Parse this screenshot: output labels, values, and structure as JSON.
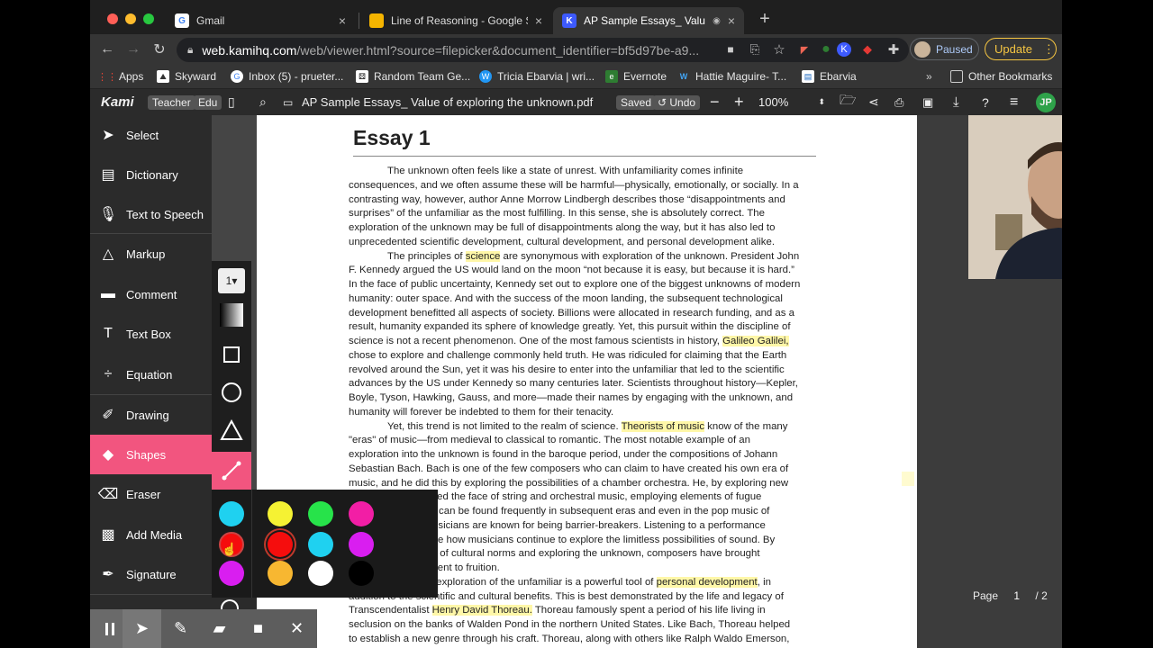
{
  "tabs": [
    {
      "title": "Gmail",
      "favicon": "google-icon"
    },
    {
      "title": "Line of Reasoning - Google Sli...",
      "favicon": "slides-icon"
    },
    {
      "title": "AP Sample Essays_ Value o...",
      "favicon": "kami-icon"
    }
  ],
  "url": {
    "host": "web.kamihq.com",
    "path": "/web/viewer.html?source=filepicker&document_identifier=bf5d97be-a9..."
  },
  "profile": {
    "status": "Paused"
  },
  "update_label": "Update",
  "bookmarks": [
    "Apps",
    "Skyward",
    "Inbox (5) - prueter...",
    "Random Team Ge...",
    "Tricia Ebarvia | wri...",
    "Evernote",
    "Hattie Maguire- T...",
    "Ebarvia"
  ],
  "other_bookmarks": "Other Bookmarks",
  "kami": {
    "logo": "Kami",
    "teacher": "Teacher",
    "edu": "Edu",
    "doc_title": "AP Sample Essays_ Value of exploring the unknown.pdf",
    "saved": "Saved",
    "undo": "Undo",
    "zoom": "100%",
    "avatar": "JP"
  },
  "sidebar": [
    {
      "label": "Select",
      "icon": "cursor-icon"
    },
    {
      "label": "Dictionary",
      "icon": "book-icon"
    },
    {
      "label": "Text to Speech",
      "icon": "speech-icon"
    },
    {
      "label": "Markup",
      "icon": "markup-icon"
    },
    {
      "label": "Comment",
      "icon": "comment-icon"
    },
    {
      "label": "Text Box",
      "icon": "text-icon"
    },
    {
      "label": "Equation",
      "icon": "divide-icon"
    },
    {
      "label": "Drawing",
      "icon": "brush-icon"
    },
    {
      "label": "Shapes",
      "icon": "shapes-icon"
    },
    {
      "label": "Eraser",
      "icon": "eraser-icon"
    },
    {
      "label": "Add Media",
      "icon": "media-icon"
    },
    {
      "label": "Signature",
      "icon": "pen-nib-icon"
    }
  ],
  "flyout": {
    "stroke_width": "1"
  },
  "palette_colors": [
    "#1fd1f0",
    "#f5f233",
    "#27e34a",
    "#f21ea5",
    "#f50d0d",
    "#f50d0d",
    "#1fd1f0",
    "#d91ef0",
    "#d91ef0",
    "#f7b731",
    "#ffffff",
    "#000000"
  ],
  "essay": {
    "title": "Essay 1",
    "lines": [
      [
        "",
        "The unknown often feels like a state of unrest. With unfamiliarity comes infinite",
        ""
      ],
      [
        "",
        "consequences, and we often assume these will be harmful—physically, emotionally, or socially. In a",
        ""
      ],
      [
        "",
        "contrasting way, however, author Anne Morrow Lindbergh describes those “disappointments and",
        ""
      ],
      [
        "",
        "surprises” of the unfamiliar as the most fulfilling. In this sense, she is absolutely correct. The",
        ""
      ],
      [
        "",
        "exploration of the unknown may be full of disappointments along the way, but it has also led to",
        ""
      ],
      [
        "",
        "unprecedented scientific development, cultural development, and personal development alike.",
        ""
      ],
      [
        "The principles of ",
        "science",
        " are synonymous with exploration of the unknown. President John"
      ],
      [
        "",
        "F. Kennedy argued the US would land on the moon “not because it is easy, but because it is hard.”",
        ""
      ],
      [
        "",
        "In the face of public uncertainty, Kennedy set out to explore one of the biggest unknowns of modern",
        ""
      ],
      [
        "",
        "humanity: outer space. And with the success of the moon landing, the subsequent technological",
        ""
      ],
      [
        "",
        "development benefitted all aspects of society. Billions were allocated in research funding, and as a",
        ""
      ],
      [
        "",
        "result, humanity expanded its sphere of knowledge greatly. Yet, this pursuit within the discipline of",
        ""
      ],
      [
        "science is not a recent phenomenon. One of the most famous scientists in history, ",
        "Galileo Galilei,",
        ""
      ],
      [
        "",
        "chose to explore and challenge commonly held truth. He was ridiculed for claiming that the Earth",
        ""
      ],
      [
        "",
        "revolved around the Sun, yet it was his desire to enter into the unfamiliar that led to the scientific",
        ""
      ],
      [
        "",
        "advances by the US under Kennedy so many centuries later. Scientists throughout history—Kepler,",
        ""
      ],
      [
        "",
        "Boyle, Tyson, Hawking, Gauss, and more—made their names by engaging with the unknown, and",
        ""
      ],
      [
        "",
        "humanity will forever be indebted to them for their tenacity.",
        ""
      ],
      [
        "Yet, this trend is not limited to the realm of science. ",
        "Theorists of music",
        " know of the many"
      ],
      [
        "",
        "\"eras\" of music—from medieval to classical to romantic. The most notable example of an",
        ""
      ],
      [
        "",
        "exploration into the unknown is found in the baroque period, under the compositions of Johann",
        ""
      ],
      [
        "",
        "Sebastian Bach. Bach is one of the few composers who can claim to have created his own era of",
        ""
      ],
      [
        "",
        "music, and he did this by exploring the possibilities of a chamber orchestra. He, by exploring new",
        ""
      ],
      [
        "",
        "ory in music, changed the face of string and orchestral music, employing elements of fugue",
        ""
      ],
      [
        "",
        "countermelody that can be found frequently in subsequent eras and even in the pop music of",
        ""
      ],
      [
        "",
        ". Like scientists, musicians are known for being barrier-breakers. Listening to a performance",
        ""
      ],
      [
        "",
        "ch's will demonstrate how musicians continue to explore the limitless possibilities of sound. By",
        ""
      ],
      [
        "",
        "king the constraints of cultural norms and exploring the unknown, composers have brought",
        ""
      ],
      [
        "",
        "g cultural development to fruition.",
        ""
      ],
      [
        "Finally, an exploration of the unfamiliar is a powerful tool of ",
        "personal development",
        ", in"
      ],
      [
        "",
        "addition to the scientific and cultural benefits. This is best demonstrated by the life and legacy of",
        ""
      ],
      [
        "Transcendentalist ",
        "Henry David Thoreau.",
        " Thoreau famously spent a period of his life living in"
      ],
      [
        "",
        "seclusion on the banks of Walden Pond in the northern United States. Like Bach, Thoreau helped",
        ""
      ],
      [
        "",
        "to establish a new genre through his craft. Thoreau, along with others like Ralph Waldo Emerson,",
        ""
      ]
    ]
  },
  "pager": {
    "label": "Page",
    "current": "1",
    "total": "/ 2"
  }
}
